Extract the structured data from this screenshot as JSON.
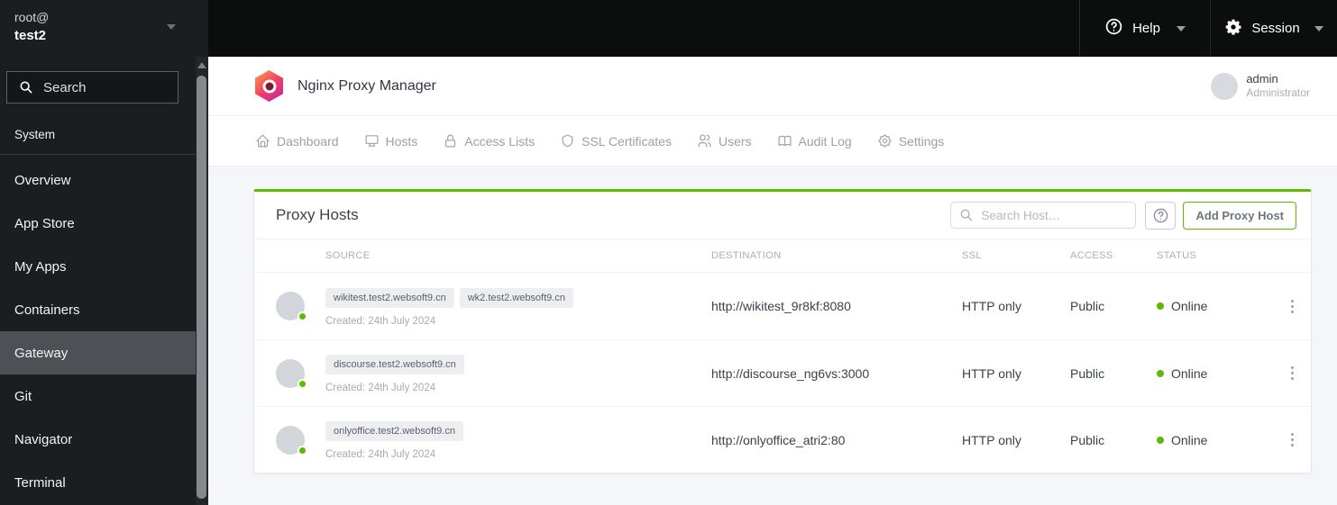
{
  "topbar": {
    "user": "root@",
    "host": "test2",
    "help_label": "Help",
    "session_label": "Session"
  },
  "sidebar": {
    "search_placeholder": "Search",
    "section_label": "System",
    "items": [
      {
        "label": "Overview",
        "active": false
      },
      {
        "label": "App Store",
        "active": false
      },
      {
        "label": "My Apps",
        "active": false
      },
      {
        "label": "Containers",
        "active": false
      },
      {
        "label": "Gateway",
        "active": true
      },
      {
        "label": "Git",
        "active": false
      },
      {
        "label": "Navigator",
        "active": false
      },
      {
        "label": "Terminal",
        "active": false
      }
    ]
  },
  "app_header": {
    "title": "Nginx Proxy Manager",
    "user_name": "admin",
    "user_role": "Administrator"
  },
  "nav_tabs": [
    {
      "label": "Dashboard",
      "icon": "home-icon"
    },
    {
      "label": "Hosts",
      "icon": "monitor-icon"
    },
    {
      "label": "Access Lists",
      "icon": "lock-icon"
    },
    {
      "label": "SSL Certificates",
      "icon": "shield-icon"
    },
    {
      "label": "Users",
      "icon": "users-icon"
    },
    {
      "label": "Audit Log",
      "icon": "book-icon"
    },
    {
      "label": "Settings",
      "icon": "gear-icon"
    }
  ],
  "proxy_hosts": {
    "title": "Proxy Hosts",
    "search_placeholder": "Search Host…",
    "add_button_label": "Add Proxy Host",
    "columns": [
      "SOURCE",
      "DESTINATION",
      "SSL",
      "ACCESS",
      "STATUS"
    ],
    "rows": [
      {
        "sources": [
          "wikitest.test2.websoft9.cn",
          "wk2.test2.websoft9.cn"
        ],
        "created": "Created: 24th July 2024",
        "destination": "http://wikitest_9r8kf:8080",
        "ssl": "HTTP only",
        "access": "Public",
        "status": "Online"
      },
      {
        "sources": [
          "discourse.test2.websoft9.cn"
        ],
        "created": "Created: 24th July 2024",
        "destination": "http://discourse_ng6vs:3000",
        "ssl": "HTTP only",
        "access": "Public",
        "status": "Online"
      },
      {
        "sources": [
          "onlyoffice.test2.websoft9.cn"
        ],
        "created": "Created: 24th July 2024",
        "destination": "http://onlyoffice_atri2:80",
        "ssl": "HTTP only",
        "access": "Public",
        "status": "Online"
      }
    ]
  },
  "colors": {
    "accent_green": "#5eba00",
    "topbar_bg": "#0c0d0d",
    "sidebar_bg": "#1b1d21",
    "sidebar_active": "#4d5054",
    "main_bg": "#f4f6f9"
  }
}
